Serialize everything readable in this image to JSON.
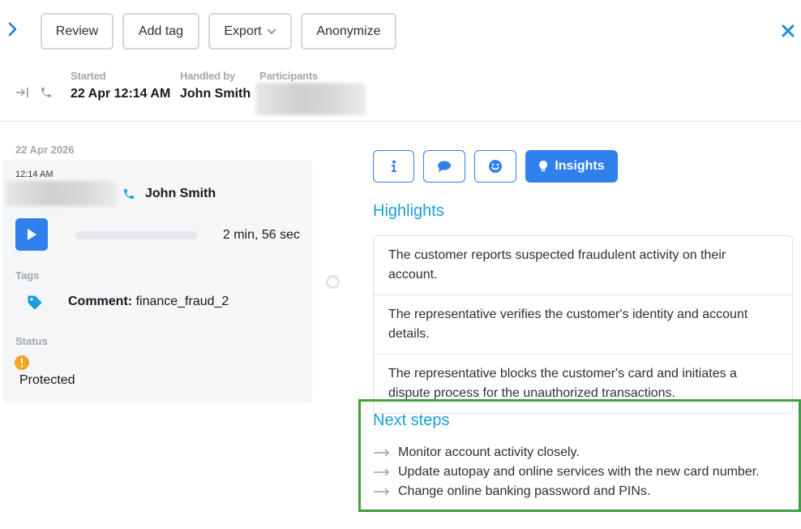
{
  "toolbar": {
    "review_label": "Review",
    "add_tag_label": "Add tag",
    "export_label": "Export",
    "anonymize_label": "Anonymize"
  },
  "meta": {
    "started_label": "Started",
    "started_value": "22 Apr 12:14 AM",
    "handled_by_label": "Handled by",
    "handled_by_value": "John Smith",
    "participants_label": "Participants"
  },
  "conversation": {
    "date_heading": "22 Apr 2026",
    "time": "12:14 AM",
    "agent_name": "John Smith",
    "duration": "2 min, 56 sec",
    "playback_progress_percent": 0,
    "tags_label": "Tags",
    "tag_key": "Comment:",
    "tag_value": "finance_fraud_2",
    "status_label": "Status",
    "status_value": "Protected"
  },
  "panel": {
    "tabs": [
      {
        "icon": "info-icon"
      },
      {
        "icon": "chat-icon"
      },
      {
        "icon": "smiley-icon"
      },
      {
        "icon": "lightbulb-icon",
        "label": "Insights",
        "active": true
      }
    ],
    "highlights_title": "Highlights",
    "highlights": [
      "The customer reports suspected fraudulent activity on their account.",
      "The representative verifies the customer's identity and account details.",
      "The representative blocks the customer's card and initiates a dispute process for the unauthorized transactions."
    ],
    "next_steps_title": "Next steps",
    "next_steps": [
      "Monitor account activity closely.",
      "Update autopay and online services with the new card number.",
      "Change online banking password and PINs."
    ]
  },
  "colors": {
    "accent": "#2f80ed",
    "section_title": "#1a9fd6",
    "status_warning": "#f5a623",
    "next_steps_outline": "#40a040"
  }
}
